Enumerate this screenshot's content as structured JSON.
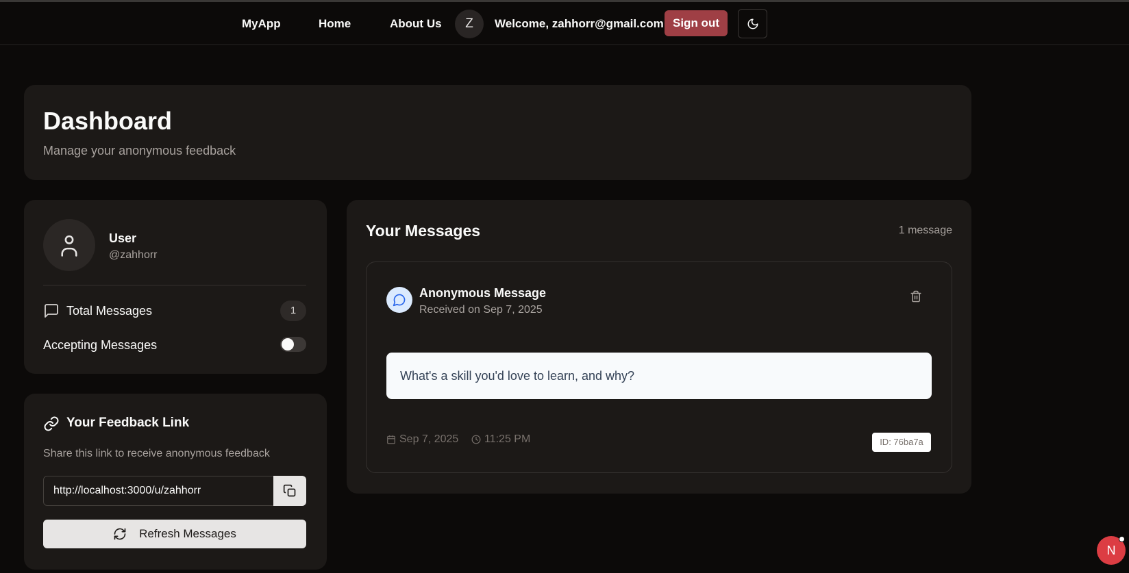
{
  "nav": {
    "brand": "MyApp",
    "links": [
      "Home",
      "About Us"
    ],
    "avatar_initial": "Z",
    "welcome": "Welcome, zahhorr@gmail.com",
    "sign_out": "Sign out",
    "theme_icon": "moon-icon"
  },
  "dashboard": {
    "title": "Dashboard",
    "subtitle": "Manage your anonymous feedback"
  },
  "profile": {
    "name": "User",
    "handle": "@zahhorr",
    "total_messages_label": "Total Messages",
    "total_messages_count": "1",
    "accepting_label": "Accepting Messages",
    "accepting_enabled": false
  },
  "feedback_link": {
    "title": "Your Feedback Link",
    "description": "Share this link to receive anonymous feedback",
    "url": "http://localhost:3000/u/zahhorr",
    "refresh_label": "Refresh Messages"
  },
  "messages": {
    "title": "Your Messages",
    "count_label": "1 message",
    "items": [
      {
        "title": "Anonymous Message",
        "received": "Received on Sep 7, 2025",
        "content": "What's a skill you'd love to learn, and why?",
        "date": "Sep 7, 2025",
        "time": "11:25 PM",
        "id_label": "ID: 76ba7a"
      }
    ]
  },
  "floating_badge": {
    "letter": "N"
  },
  "colors": {
    "background": "#0c0a09",
    "card": "#1c1917",
    "sign_out": "#9f3f45",
    "message_icon_bg": "#dbeafe",
    "message_icon": "#2563eb",
    "floating_badge": "#dc3d43"
  }
}
